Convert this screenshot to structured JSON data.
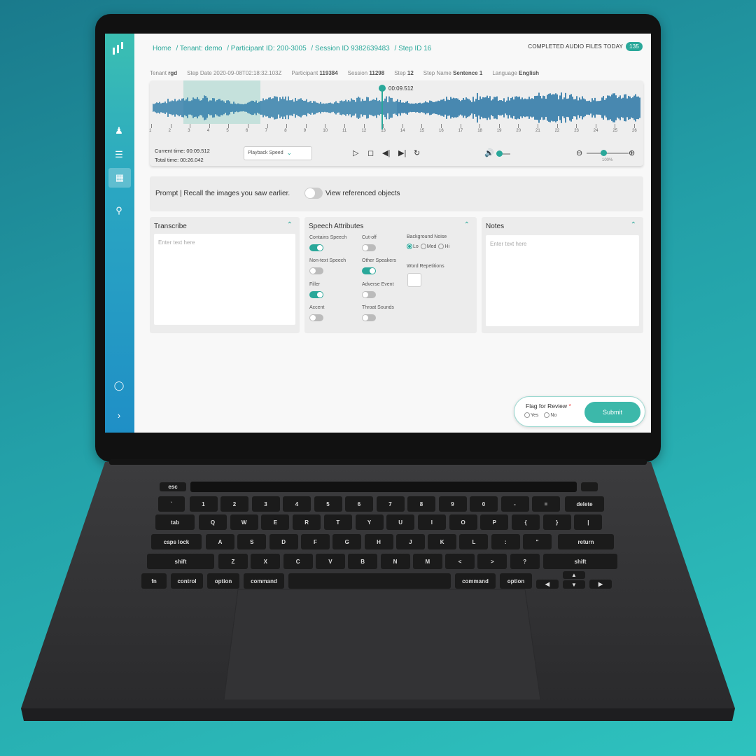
{
  "breadcrumb": {
    "home": "Home",
    "tenant": "/ Tenant: demo",
    "participant": "/ Participant ID: 200-3005",
    "session": "/ Session ID 9382639483",
    "step": "/ Step ID 16"
  },
  "completed": {
    "label": "COMPLETED AUDIO FILES TODAY",
    "count": "135"
  },
  "meta": [
    {
      "label": "Tenant",
      "value": "rgd"
    },
    {
      "label": "Step Date",
      "value": "2020-09-08T02:18:32.103Z"
    },
    {
      "label": "Participant",
      "value": "119384"
    },
    {
      "label": "Session",
      "value": "11298"
    },
    {
      "label": "Step",
      "value": "12"
    },
    {
      "label": "Step Name",
      "value": "Sentence 1"
    },
    {
      "label": "Language",
      "value": "English"
    }
  ],
  "player": {
    "marker_time": "00:09.512",
    "current_time": "Current time: 00:09.512",
    "total_time": "Total time: 00:26.042",
    "playback_speed": "Playback Speed",
    "zoom": "100%",
    "ticks": [
      "1",
      "2",
      "3",
      "4",
      "5",
      "6",
      "7",
      "8",
      "9",
      "10",
      "11",
      "12",
      "13",
      "14",
      "15",
      "16",
      "17",
      "18",
      "19",
      "20",
      "21",
      "22",
      "23",
      "24",
      "25",
      "26"
    ]
  },
  "prompt": {
    "text": "Prompt | Recall the images you saw earlier.",
    "view_ref": "View referenced objects"
  },
  "transcribe": {
    "title": "Transcribe",
    "placeholder": "Enter text here"
  },
  "speech": {
    "title": "Speech Attributes",
    "contains_speech": "Contains Speech",
    "cut_off": "Cut-off",
    "background_noise": "Background Noise",
    "noise_options": [
      "Lo",
      "Med",
      "Hi"
    ],
    "non_text": "Non-text Speech",
    "other_speakers": "Other Speakers",
    "word_rep": "Word Repetitions",
    "filler": "Filler",
    "adverse": "Adverse Event",
    "accent": "Accent",
    "throat": "Throat Sounds"
  },
  "notes": {
    "title": "Notes",
    "placeholder": "Enter text here"
  },
  "flag": {
    "title": "Flag for Review",
    "req": "*",
    "yes": "Yes",
    "no": "No",
    "submit": "Submit"
  },
  "keys": {
    "esc": "esc",
    "delete": "delete",
    "tab": "tab",
    "caps": "caps lock",
    "return": "return",
    "shift": "shift",
    "fn": "fn",
    "control": "control",
    "option": "option",
    "command": "command",
    "cmd_sym": "⌘",
    "row1": [
      "~",
      "!",
      "@",
      "#",
      "$",
      "%",
      "^",
      "&",
      "*",
      "(",
      ")",
      "_",
      "+"
    ],
    "row1b": [
      "`",
      "1",
      "2",
      "3",
      "4",
      "5",
      "6",
      "7",
      "8",
      "9",
      "0",
      "-",
      "="
    ],
    "row2": [
      "Q",
      "W",
      "E",
      "R",
      "T",
      "Y",
      "U",
      "I",
      "O",
      "P",
      "{",
      "}",
      "|"
    ],
    "row3": [
      "A",
      "S",
      "D",
      "F",
      "G",
      "H",
      "J",
      "K",
      "L",
      ":",
      "\""
    ],
    "row4": [
      "Z",
      "X",
      "C",
      "V",
      "B",
      "N",
      "M",
      "<",
      ">",
      "?"
    ]
  }
}
